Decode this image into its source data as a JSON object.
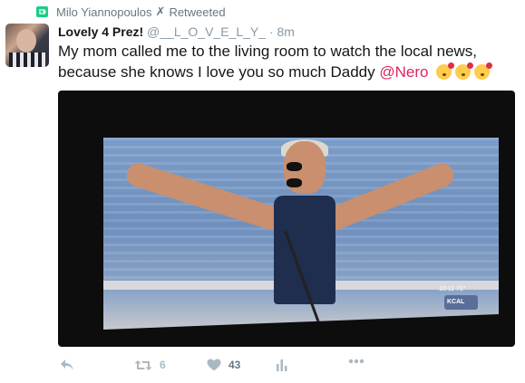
{
  "retweet_banner": {
    "retweeter": "Milo Yiannopoulos",
    "verified_glyph": "✗",
    "action": "Retweeted",
    "icon": "retweet-icon",
    "icon_color": "#19cf86"
  },
  "tweet": {
    "display_name": "Lovely 4 Prez!",
    "handle": "@__L_O_V_E_L_Y_",
    "dot": "·",
    "time": "8m",
    "text": "My mom called me to the living room to watch the local news, because she knows I love you so much Daddy ",
    "mention": "@Nero",
    "emoji_count": 3,
    "mention_color": "#e0245e"
  },
  "media": {
    "tv_clock": "10:11  71°",
    "tv_logo": "KCAL"
  },
  "actions": {
    "reply_icon": "reply-icon",
    "retweet_icon": "retweet-icon",
    "retweet_count": "6",
    "like_icon": "heart-icon",
    "like_count": "43",
    "analytics_icon": "analytics-icon",
    "more_icon": "more-icon",
    "icon_color": "#aab8c2"
  }
}
